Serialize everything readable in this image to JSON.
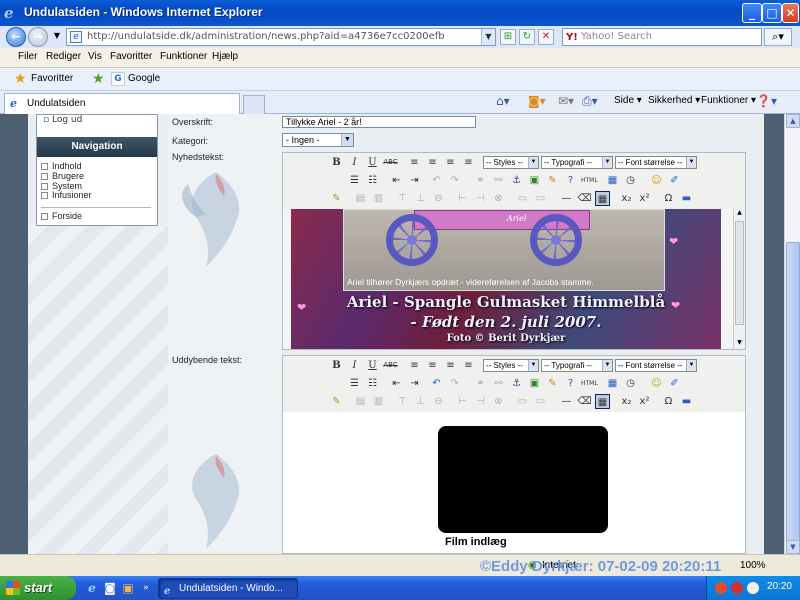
{
  "window": {
    "title": "Undulatsiden - Windows Internet Explorer"
  },
  "address": {
    "url": "http://undulatside.dk/administration/news.php?aid=a4736e7cc0200efb"
  },
  "search": {
    "placeholder": "Yahoo! Search"
  },
  "menu": [
    "Filer",
    "Rediger",
    "Vis",
    "Favoritter",
    "Funktioner",
    "Hjælp"
  ],
  "favorites": {
    "label": "Favoritter",
    "google": "Google"
  },
  "tab": {
    "label": "Undulatsiden"
  },
  "commands": {
    "side": "Side",
    "sikkerhed": "Sikkerhed",
    "funktioner": "Funktioner"
  },
  "sidebar": {
    "logout": "Log ud",
    "heading": "Navigation",
    "items": [
      "Indhold",
      "Brugere",
      "System",
      "Infusioner"
    ],
    "forside": "Forside"
  },
  "form": {
    "overskrift_label": "Overskrift:",
    "overskrift_value": "Tillykke Ariel - 2 år!",
    "kategori_label": "Kategori:",
    "kategori_value": "- Ingen -",
    "nyhedstekst_label": "Nyhedstekst:",
    "uddybende_label": "Uddybende tekst:"
  },
  "toolbar": {
    "bold": "B",
    "italic": "I",
    "underline": "U",
    "strike": "ABC",
    "styles": "-- Styles --",
    "typografi": "-- Typografi --",
    "fontsize": "-- Font størrelse --",
    "sub": "x₂",
    "sup": "x²",
    "omega": "Ω",
    "html": "HTML"
  },
  "photo": {
    "cart_label": "Ariel",
    "caption": "Ariel tilhører Dyrkjærs opdræt - videreførelsen af Jacobs stamme.",
    "line1": "Ariel - Spangle Gulmasket Himmelblå",
    "line2": "- Født den 2. juli 2007.",
    "line3": "Foto © Berit Dyrkjær"
  },
  "video": {
    "caption": "Film indlæg"
  },
  "status": {
    "zone": "Internet",
    "zoom": "100%",
    "watermark": "©Eddy Dyrkjær: 07-02-09 20:20:11"
  },
  "taskbar": {
    "start": "start",
    "window": "Undulatsiden - Windo...",
    "clock": "20:20"
  },
  "colors": {
    "titlebar": "#0548c0",
    "nav_header": "#2f4658",
    "page_frame": "#4d6072"
  }
}
